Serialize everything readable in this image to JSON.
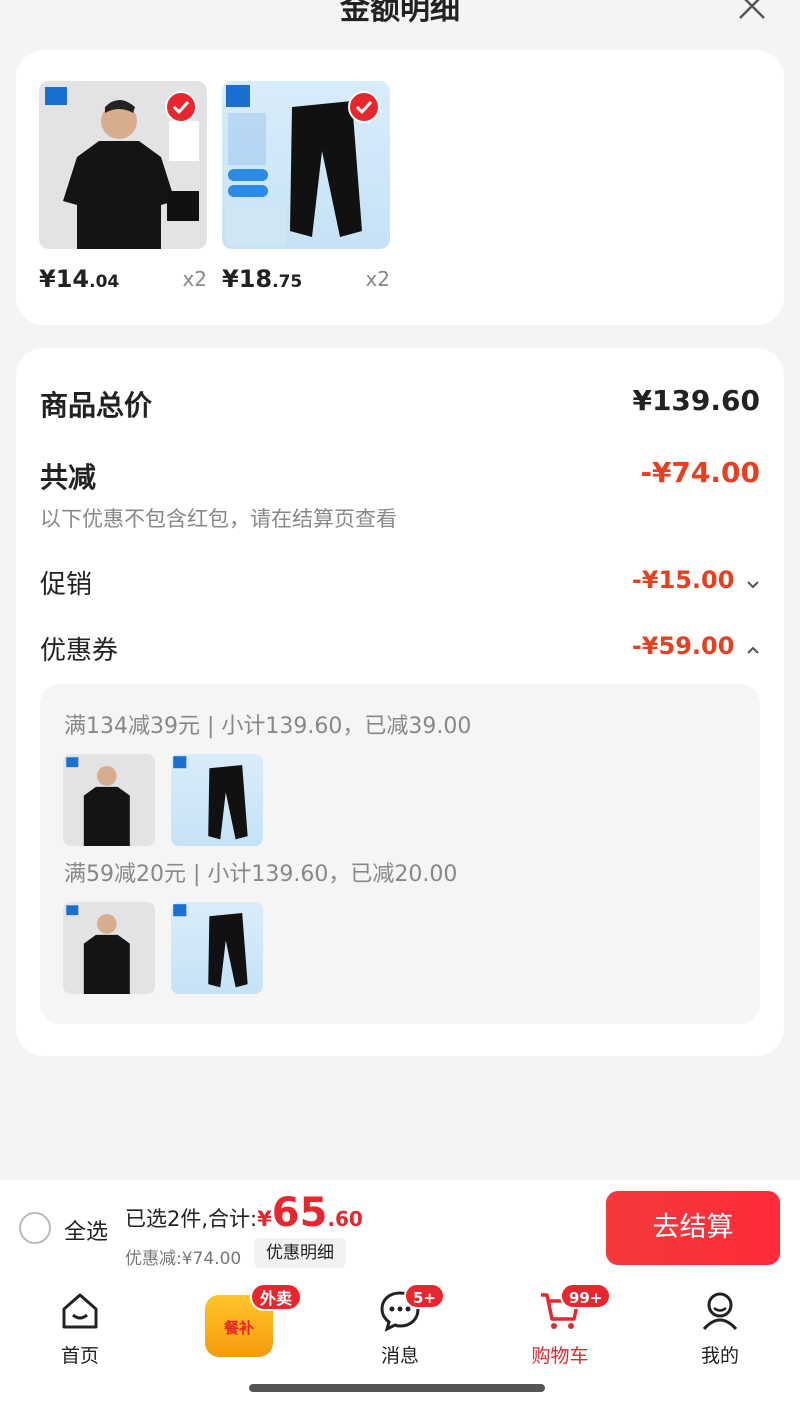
{
  "header": {
    "title": "金额明细"
  },
  "products": [
    {
      "price_int": "¥14",
      "price_dec": ".04",
      "qty": "x2"
    },
    {
      "price_int": "¥18",
      "price_dec": ".75",
      "qty": "x2"
    }
  ],
  "details": {
    "total_label": "商品总价",
    "total_value": "¥139.60",
    "reduce_label": "共减",
    "reduce_value": "-¥74.00",
    "note": "以下优惠不包含红包，请在结算页查看",
    "promo_label": "促销",
    "promo_value": "-¥15.00",
    "coupon_label": "优惠券",
    "coupon_value": "-¥59.00",
    "coupons": [
      {
        "text": "满134减39元 | 小计139.60，已减39.00"
      },
      {
        "text": "满59减20元 | 小计139.60，已减20.00"
      }
    ]
  },
  "bottom_bar": {
    "select_all": "全选",
    "summary_text": "已选2件,合计:",
    "currency": "¥",
    "total_int": "65",
    "total_dec": ".60",
    "discount_text": "优惠减:¥74.00",
    "detail_button": "优惠明细",
    "checkout_button": "去结算"
  },
  "tabs": [
    {
      "label": "首页"
    },
    {
      "label": "消息",
      "badge": "5+"
    },
    {
      "label": "购物车",
      "badge": "99+"
    },
    {
      "label": "我的"
    }
  ],
  "meal": {
    "label": "餐补",
    "badge": "外卖"
  },
  "colors": {
    "accent": "#e8262d",
    "discount": "#e8401f"
  }
}
